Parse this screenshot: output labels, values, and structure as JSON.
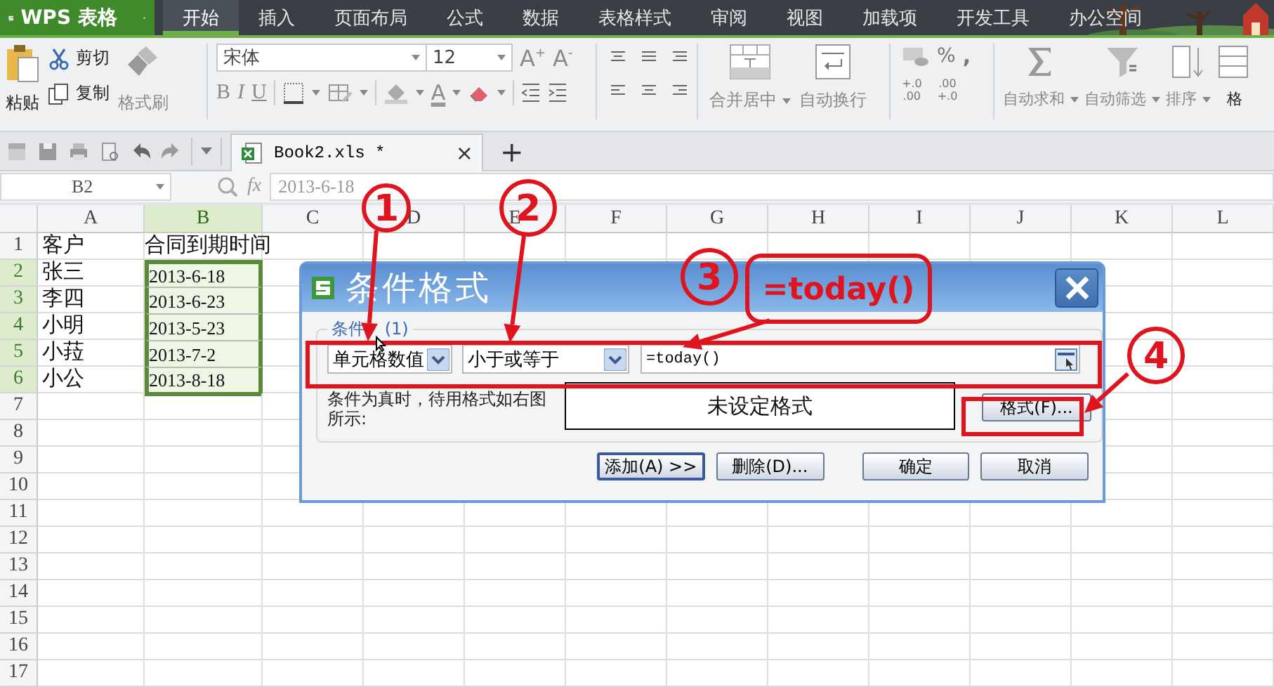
{
  "app_menu": {
    "label": "WPS 表格"
  },
  "menu_tabs": [
    {
      "label": "开始",
      "selected": true
    },
    {
      "label": "插入",
      "selected": false
    },
    {
      "label": "页面布局",
      "selected": false
    },
    {
      "label": "公式",
      "selected": false
    },
    {
      "label": "数据",
      "selected": false
    },
    {
      "label": "表格样式",
      "selected": false
    },
    {
      "label": "审阅",
      "selected": false
    },
    {
      "label": "视图",
      "selected": false
    },
    {
      "label": "加载项",
      "selected": false
    },
    {
      "label": "开发工具",
      "selected": false
    },
    {
      "label": "办公空间",
      "selected": false
    }
  ],
  "ribbon": {
    "paste": {
      "label": "粘贴",
      "disabled": false
    },
    "cut": {
      "label": "剪切",
      "disabled": false
    },
    "copy": {
      "label": "复制",
      "disabled": false
    },
    "format_painter": {
      "label": "格式刷",
      "disabled": true
    },
    "font_name": "宋体",
    "font_size": "12",
    "grow_font": "A$^{+}$",
    "shrink_font": "A$^{-}$",
    "bold": "B",
    "italic": "I",
    "underline": "U",
    "font_color": "A",
    "merge": {
      "label": "合并居中",
      "disabled": true
    },
    "wrap": {
      "label": "自动换行",
      "disabled": true
    },
    "percent": "%",
    "comma": ",",
    "decimals": [
      {
        "top": "+.0",
        "bottom": ".00"
      },
      {
        "top": ".00",
        "bottom": "+.0"
      }
    ],
    "editing": [
      {
        "label": "自动求和",
        "disabled": true,
        "dropdown": true
      },
      {
        "label": "自动筛选",
        "disabled": true,
        "dropdown": true
      },
      {
        "label": "排序",
        "disabled": true,
        "dropdown": true
      },
      {
        "label": "格",
        "disabled": false,
        "dropdown": false
      }
    ]
  },
  "doc_tabs": [
    {
      "label": "Book2.xls *",
      "selected": true,
      "close": "×"
    }
  ],
  "new_tab": "+",
  "formula_bar": {
    "cell_ref": "B2",
    "fx": "fx",
    "value": "2013-6-18"
  },
  "sheet": {
    "columns": [
      {
        "label": "A",
        "selected": false
      },
      {
        "label": "B",
        "selected": true
      },
      {
        "label": "C",
        "selected": false
      },
      {
        "label": "D",
        "selected": false
      },
      {
        "label": "E",
        "selected": false
      },
      {
        "label": "F",
        "selected": false
      },
      {
        "label": "G",
        "selected": false
      },
      {
        "label": "H",
        "selected": false
      },
      {
        "label": "I",
        "selected": false
      },
      {
        "label": "J",
        "selected": false
      },
      {
        "label": "K",
        "selected": false
      },
      {
        "label": "L",
        "selected": false
      }
    ],
    "rows": [
      {
        "label": "1",
        "selected": false,
        "cells": [
          {
            "text": "客户",
            "selected": false
          },
          {
            "text": "合同到期时间",
            "selected": false
          }
        ]
      },
      {
        "label": "2",
        "selected": true,
        "cells": [
          {
            "text": "张三",
            "selected": false
          },
          {
            "text": "2013-6-18",
            "selected": true
          }
        ]
      },
      {
        "label": "3",
        "selected": true,
        "cells": [
          {
            "text": "李四",
            "selected": false
          },
          {
            "text": "2013-6-23",
            "selected": true
          }
        ]
      },
      {
        "label": "4",
        "selected": true,
        "cells": [
          {
            "text": "小明",
            "selected": false
          },
          {
            "text": "2013-5-23",
            "selected": true
          }
        ]
      },
      {
        "label": "5",
        "selected": true,
        "cells": [
          {
            "text": "小菈",
            "selected": false
          },
          {
            "text": "2013-7-2",
            "selected": true
          }
        ]
      },
      {
        "label": "6",
        "selected": true,
        "cells": [
          {
            "text": "小公",
            "selected": false
          },
          {
            "text": "2013-8-18",
            "selected": true
          }
        ]
      },
      {
        "label": "7",
        "selected": false
      },
      {
        "label": "8",
        "selected": false
      },
      {
        "label": "9",
        "selected": false
      },
      {
        "label": "10",
        "selected": false
      },
      {
        "label": "11",
        "selected": false
      },
      {
        "label": "12",
        "selected": false
      },
      {
        "label": "13",
        "selected": false
      },
      {
        "label": "14",
        "selected": false
      },
      {
        "label": "15",
        "selected": false
      },
      {
        "label": "16",
        "selected": false
      },
      {
        "label": "17",
        "selected": false
      }
    ]
  },
  "dialog": {
    "title": "条件格式",
    "group_label": "条件 (1)",
    "condition": {
      "type": "单元格数值",
      "operator": "小于或等于",
      "formula": "=today()"
    },
    "preview_label": "条件为真时，待用格式如右图所示:",
    "preview": "未设定格式",
    "format_button": "格式(F)...",
    "buttons": [
      {
        "label": "添加(A) >>",
        "focused": true
      },
      {
        "label": "删除(D)...",
        "focused": false
      },
      {
        "label": "确定",
        "focused": false
      },
      {
        "label": "取消",
        "focused": false
      }
    ]
  },
  "annotations": {
    "steps": [
      "1",
      "2",
      "3",
      "4"
    ],
    "callout": "=today()"
  }
}
